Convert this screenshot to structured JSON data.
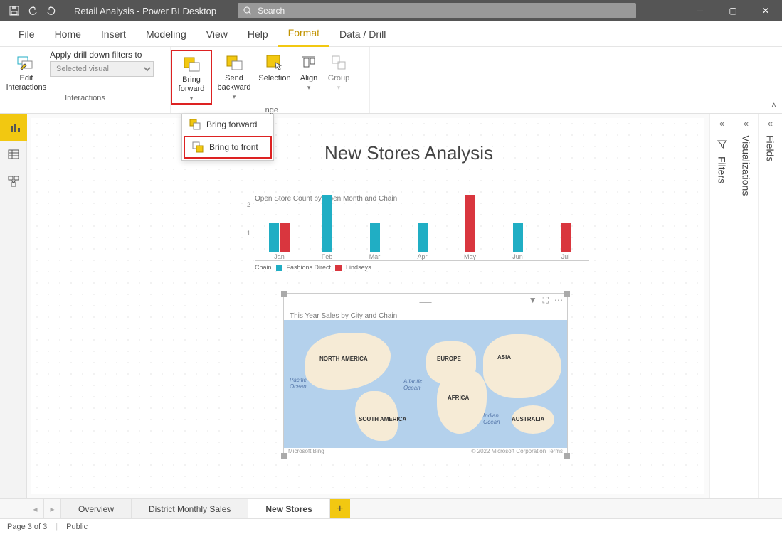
{
  "app_title": "Retail Analysis - Power BI Desktop",
  "search_placeholder": "Search",
  "menu": [
    "File",
    "Home",
    "Insert",
    "Modeling",
    "View",
    "Help",
    "Format",
    "Data / Drill"
  ],
  "ribbon": {
    "interactions": {
      "edit_interactions": "Edit\ninteractions",
      "drill_label": "Apply drill down filters to",
      "drill_selected": "Selected visual",
      "group_label": "Interactions"
    },
    "arrange": {
      "bring_forward": "Bring\nforward",
      "send_backward": "Send\nbackward",
      "selection": "Selection",
      "align": "Align",
      "group": "Group",
      "group_label": "nge"
    }
  },
  "dropdown": {
    "item1": "Bring forward",
    "item2": "Bring to front"
  },
  "canvas_title": "New Stores Analysis",
  "chart_data": {
    "type": "bar",
    "title": "Open Store Count by Open Month and Chain",
    "ylabel": "",
    "ylim": [
      0,
      2
    ],
    "categories": [
      "Jan",
      "Feb",
      "Mar",
      "Apr",
      "May",
      "Jun",
      "Jul"
    ],
    "series": [
      {
        "name": "Fashions Direct",
        "values": [
          1,
          2,
          1,
          1,
          0,
          1,
          0
        ],
        "color": "#20aec4"
      },
      {
        "name": "Lindseys",
        "values": [
          1,
          0,
          0,
          0,
          2,
          0,
          1
        ],
        "color": "#d9363e"
      }
    ],
    "legend_prefix": "Chain"
  },
  "map": {
    "title": "This Year Sales by City and Chain",
    "labels": {
      "na": "NORTH AMERICA",
      "sa": "SOUTH AMERICA",
      "eu": "EUROPE",
      "af": "AFRICA",
      "as": "ASIA",
      "au": "AUSTRALIA",
      "pac": "Pacific\nOcean",
      "atl": "Atlantic\nOcean",
      "ind": "Indian\nOcean"
    },
    "bing": "Microsoft Bing",
    "copy": "© 2022 Microsoft Corporation  Terms"
  },
  "panels": {
    "filters": "Filters",
    "visualizations": "Visualizations",
    "fields": "Fields"
  },
  "tabs": {
    "t1": "Overview",
    "t2": "District Monthly Sales",
    "t3": "New Stores"
  },
  "status": {
    "page": "Page 3 of 3",
    "public": "Public"
  }
}
